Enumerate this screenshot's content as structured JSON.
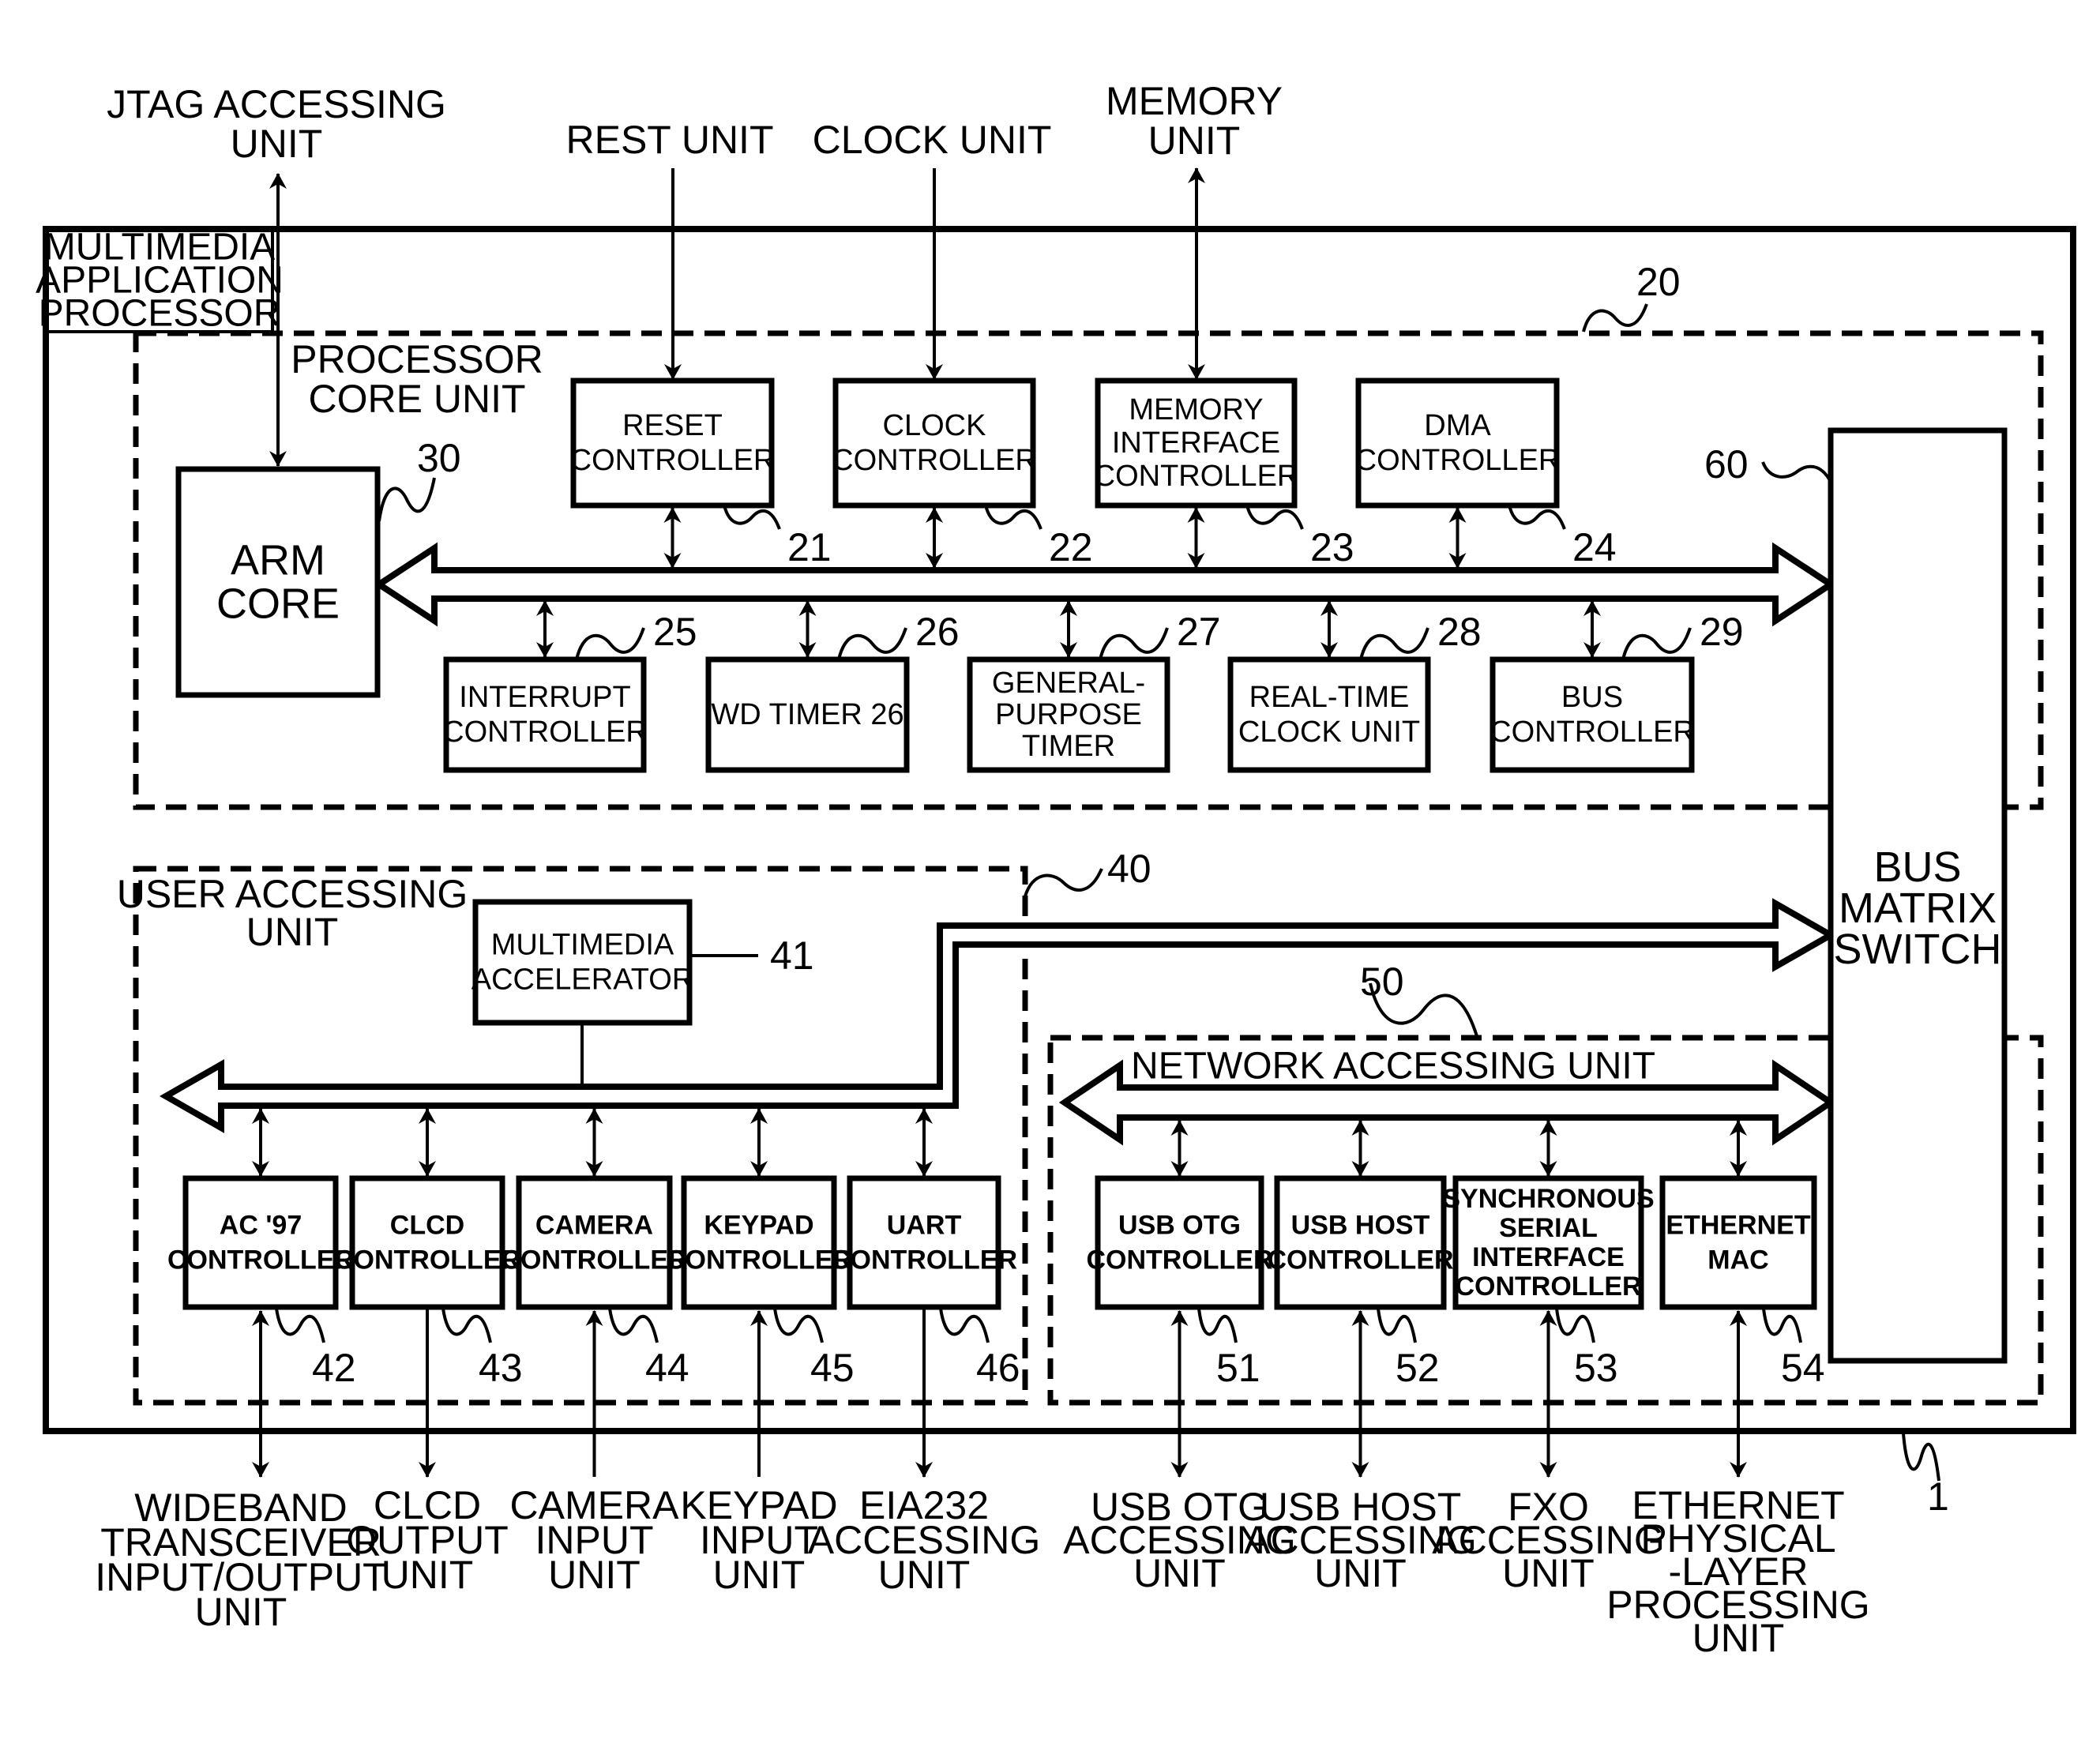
{
  "figure": {
    "system_label": [
      "MULTIMEDIA",
      "APPLICATION",
      "PROCESSOR"
    ],
    "system_ref": "1",
    "external_top": {
      "jtag": [
        "JTAG ACCESSING",
        "UNIT"
      ],
      "reset": [
        "REST UNIT"
      ],
      "clock": [
        "CLOCK UNIT"
      ],
      "memory": [
        "MEMORY",
        "UNIT"
      ]
    },
    "processor_core_unit": {
      "label": [
        "PROCESSOR",
        "CORE UNIT"
      ],
      "ref": "20",
      "arm_core": {
        "label": [
          "ARM",
          "CORE"
        ],
        "ref": "30"
      },
      "top_blocks": [
        {
          "label": [
            "RESET",
            "CONTROLLER"
          ],
          "ref": "21"
        },
        {
          "label": [
            "CLOCK",
            "CONTROLLER"
          ],
          "ref": "22"
        },
        {
          "label": [
            "MEMORY",
            "INTERFACE",
            "CONTROLLER"
          ],
          "ref": "23"
        },
        {
          "label": [
            "DMA",
            "CONTROLLER"
          ],
          "ref": "24"
        }
      ],
      "bottom_blocks": [
        {
          "label": [
            "INTERRUPT",
            "CONTROLLER"
          ],
          "ref": "25"
        },
        {
          "label": [
            "WD TIMER 26"
          ],
          "ref": "26"
        },
        {
          "label": [
            "GENERAL-",
            "PURPOSE",
            "TIMER"
          ],
          "ref": "27"
        },
        {
          "label": [
            "REAL-TIME",
            "CLOCK UNIT"
          ],
          "ref": "28"
        },
        {
          "label": [
            "BUS",
            "CONTROLLER"
          ],
          "ref": "29"
        }
      ]
    },
    "bus_matrix_switch": {
      "label": [
        "BUS",
        "MATRIX",
        "SWITCH"
      ],
      "ref": "60"
    },
    "user_accessing_unit": {
      "label": [
        "USER ACCESSING",
        "UNIT"
      ],
      "ref": "40",
      "accelerator": {
        "label": [
          "MULTIMEDIA",
          "ACCELERATOR"
        ],
        "ref": "41"
      },
      "blocks": [
        {
          "label": [
            "AC '97",
            "CONTROLLER"
          ],
          "ref": "42",
          "external": [
            "WIDEBAND",
            "TRANSCEIVER",
            "INPUT/OUTPUT",
            "UNIT"
          ],
          "direction": "both"
        },
        {
          "label": [
            "CLCD",
            "CONTROLLER"
          ],
          "ref": "43",
          "external": [
            "CLCD",
            "OUTPUT",
            "UNIT"
          ],
          "direction": "out"
        },
        {
          "label": [
            "CAMERA",
            "CONTROLLER"
          ],
          "ref": "44",
          "external": [
            "CAMERA",
            "INPUT",
            "UNIT"
          ],
          "direction": "in"
        },
        {
          "label": [
            "KEYPAD",
            "CONTROLLER"
          ],
          "ref": "45",
          "external": [
            "KEYPAD",
            "INPUT",
            "UNIT"
          ],
          "direction": "in"
        },
        {
          "label": [
            "UART",
            "CONTROLLER"
          ],
          "ref": "46",
          "external": [
            "EIA232",
            "ACCESSING",
            "UNIT"
          ],
          "direction": "out"
        }
      ]
    },
    "network_accessing_unit": {
      "label": "NETWORK ACCESSING UNIT",
      "ref": "50",
      "blocks": [
        {
          "label": [
            "USB OTG",
            "CONTROLLER"
          ],
          "ref": "51",
          "external": [
            "USB OTG",
            "ACCESSING",
            "UNIT"
          ]
        },
        {
          "label": [
            "USB HOST",
            "CONTROLLER"
          ],
          "ref": "52",
          "external": [
            "USB HOST",
            "ACCESSING",
            "UNIT"
          ]
        },
        {
          "label": [
            "SYNCHRONOUS",
            "SERIAL",
            "INTERFACE",
            "CONTROLLER"
          ],
          "ref": "53",
          "external": [
            "FXO",
            "ACCESSING",
            "UNIT"
          ]
        },
        {
          "label": [
            "ETHERNET",
            "MAC"
          ],
          "ref": "54",
          "external": [
            "ETHERNET",
            "PHYSICAL",
            "-LAYER",
            "PROCESSING",
            "UNIT"
          ]
        }
      ]
    }
  }
}
